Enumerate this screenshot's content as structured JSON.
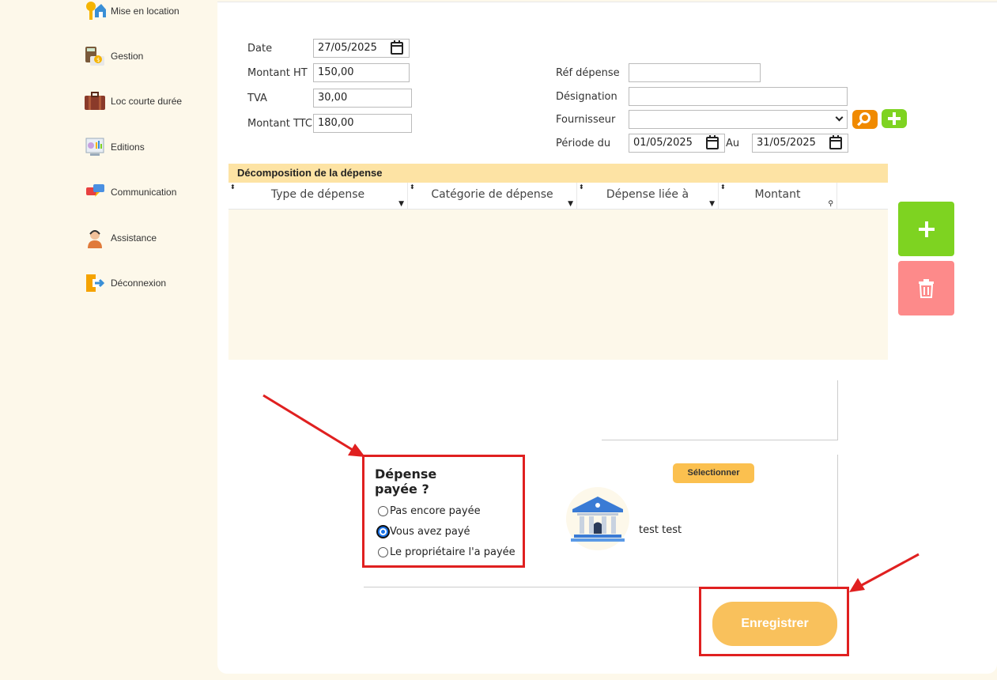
{
  "sidebar": {
    "items": [
      {
        "label": "Mise en location",
        "icon": "keys-house-icon"
      },
      {
        "label": "Gestion",
        "icon": "calculator-money-icon"
      },
      {
        "label": "Loc courte durée",
        "icon": "suitcase-icon"
      },
      {
        "label": "Editions",
        "icon": "report-chart-icon"
      },
      {
        "label": "Communication",
        "icon": "chat-bubbles-icon"
      },
      {
        "label": "Assistance",
        "icon": "support-agent-icon"
      },
      {
        "label": "Déconnexion",
        "icon": "logout-door-icon"
      }
    ]
  },
  "form": {
    "date_label": "Date",
    "date_value": "27/05/2025",
    "montant_ht_label": "Montant HT",
    "montant_ht_value": "150,00",
    "tva_label": "TVA",
    "tva_value": "30,00",
    "montant_ttc_label": "Montant TTC",
    "montant_ttc_value": "180,00",
    "ref_label": "Réf dépense",
    "ref_value": "",
    "designation_label": "Désignation",
    "designation_value": "",
    "fournisseur_label": "Fournisseur",
    "fournisseur_value": "",
    "periode_label": "Période du",
    "periode_from": "01/05/2025",
    "au_label": "Au",
    "periode_to": "31/05/2025"
  },
  "table": {
    "title": "Décomposition de la dépense",
    "columns": [
      "Type de dépense",
      "Catégorie de dépense",
      "Dépense liée à",
      "Montant"
    ],
    "rows": []
  },
  "payment": {
    "title_line1": "Dépense",
    "title_line2": "payée ?",
    "options": [
      "Pas encore payée",
      "Vous avez payé",
      "Le propriétaire l'a payée"
    ],
    "selected_index": 1
  },
  "bank": {
    "select_label": "Sélectionner",
    "name": "test test"
  },
  "save_label": "Enregistrer",
  "colors": {
    "accent_yellow": "#fbc04f",
    "add_green": "#7ed321",
    "delete_red": "#fd8a8a",
    "highlight_red": "#e02020",
    "table_header": "#fde3a4",
    "cream_bg": "#fdf8ea"
  }
}
